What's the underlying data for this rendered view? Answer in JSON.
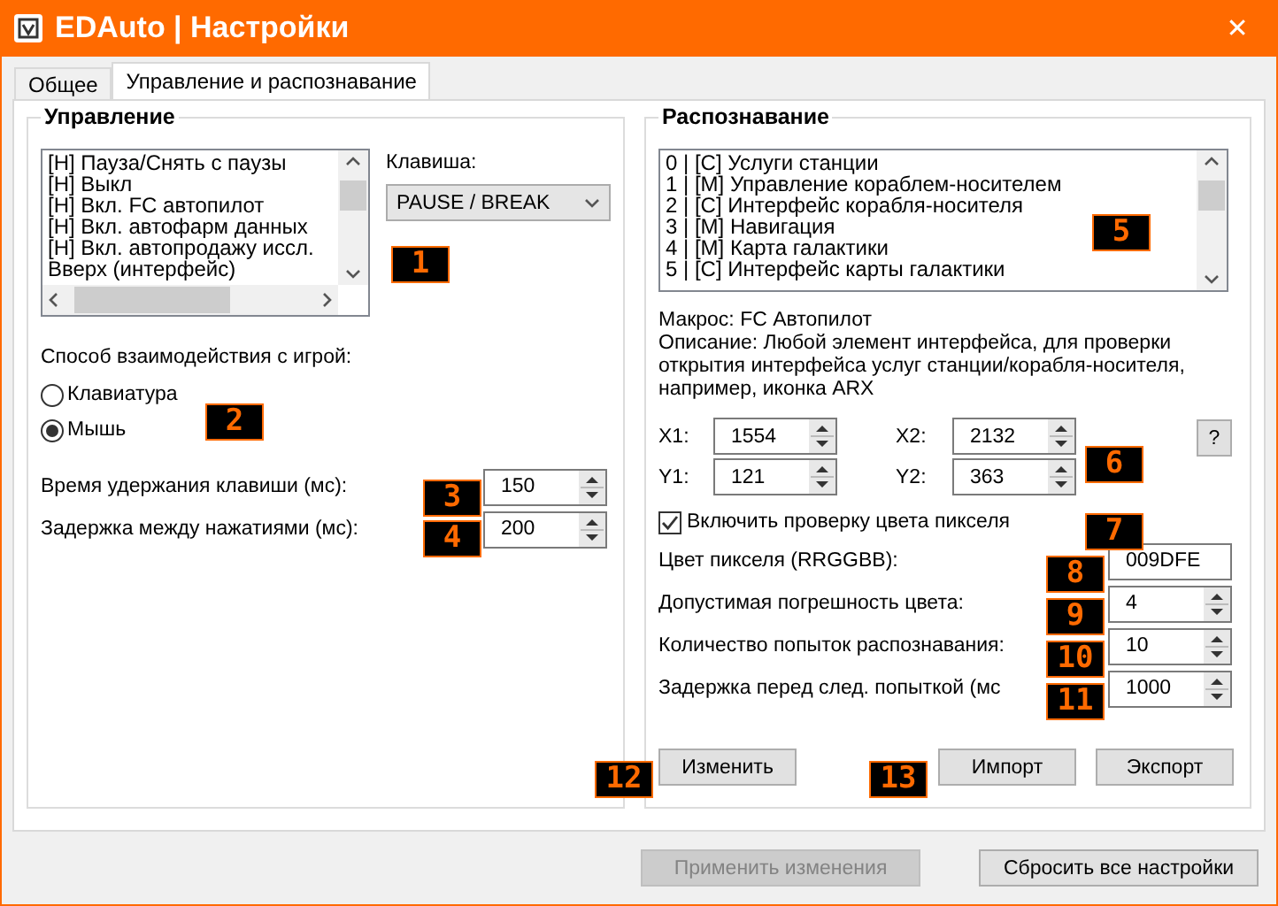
{
  "window": {
    "title": "EDAuto | Настройки",
    "close": "✕"
  },
  "tabs": [
    {
      "label": "Общее",
      "selected": false
    },
    {
      "label": "Управление и распознавание",
      "selected": true
    }
  ],
  "control": {
    "title": "Управление",
    "hotkeys": [
      "[H] Пауза/Снять с паузы",
      "[H] Выкл",
      "[H] Вкл. FC автопилот",
      "[H] Вкл. автофарм данных",
      "[H] Вкл. автопродажу иссл.",
      "Вверх (интерфейс)"
    ],
    "key_label": "Клавиша:",
    "key_value": "PAUSE / BREAK",
    "mode_label": "Способ взаимодействия с игрой:",
    "modes": [
      {
        "label": "Клавиатура",
        "selected": false
      },
      {
        "label": "Мышь",
        "selected": true
      }
    ],
    "fields": [
      {
        "label": "Время удержания клавиши (мс):",
        "value": "150"
      },
      {
        "label": "Задержка между нажатиями (мс):",
        "value": "200"
      }
    ]
  },
  "recognition": {
    "title": "Распознавание",
    "items": [
      "0 | [C] Услуги станции",
      "1 | [M] Управление кораблем-носителем",
      "2 | [C] Интерфейс корабля-носителя",
      "3 | [M] Навигация",
      "4 | [M] Карта галактики",
      "5 | [C] Интерфейс карты галактики"
    ],
    "macro": "Макрос: FC Автопилот",
    "description": "Описание: Любой элемент интерфейса, для проверки открытия интерфейса услуг станции/корабля-носителя, например, иконка ARX",
    "coords": [
      {
        "label": "X1:",
        "value": "1554"
      },
      {
        "label": "X2:",
        "value": "2132"
      },
      {
        "label": "Y1:",
        "value": "121"
      },
      {
        "label": "Y2:",
        "value": "363"
      }
    ],
    "help": "?",
    "pixel_check": {
      "label": "Включить проверку цвета пикселя",
      "checked": true
    },
    "fields": [
      {
        "label": "Цвет пикселя (RRGGBB):",
        "value": "009DFE",
        "kind": "text"
      },
      {
        "label": "Допустимая погрешность цвета:",
        "value": "4",
        "kind": "spin"
      },
      {
        "label": "Количество попыток распознавания:",
        "value": "10",
        "kind": "spin"
      },
      {
        "label": "Задержка перед след. попыткой (мс",
        "value": "1000",
        "kind": "spin"
      }
    ],
    "buttons": [
      "Изменить",
      "Импорт",
      "Экспорт"
    ]
  },
  "footer": {
    "apply": {
      "label": "Применить изменения",
      "disabled": true
    },
    "reset": "Сбросить все настройки"
  },
  "markers": [
    "1",
    "2",
    "3",
    "4",
    "5",
    "6",
    "7",
    "8",
    "9",
    "10",
    "11",
    "12",
    "13"
  ]
}
